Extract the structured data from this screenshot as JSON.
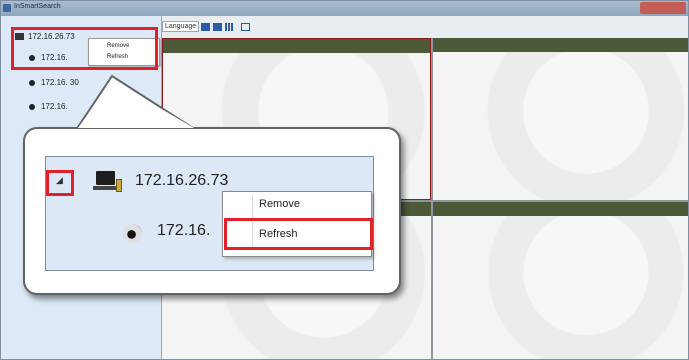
{
  "window": {
    "title": "InSmartSearch"
  },
  "toolbar": {
    "language_label": "Language"
  },
  "sidebar": {
    "server": {
      "ip": "172.16.26.73"
    },
    "cameras": [
      {
        "label": "172.16."
      },
      {
        "label": "172.16.   30"
      },
      {
        "label": "172.16."
      }
    ],
    "context_menu": {
      "items": [
        "Remove",
        "Refresh"
      ]
    }
  },
  "zoom": {
    "server_ip": "172.16.26.73",
    "camera_ip": "172.16.",
    "expand_glyph": "◢",
    "context_menu": {
      "items": [
        "Remove",
        "Refresh"
      ],
      "highlighted": "Refresh"
    }
  },
  "colors": {
    "highlight": "#e1202a",
    "tile_bar": "#4d5a3a",
    "sidebar": "#dde9f6"
  }
}
